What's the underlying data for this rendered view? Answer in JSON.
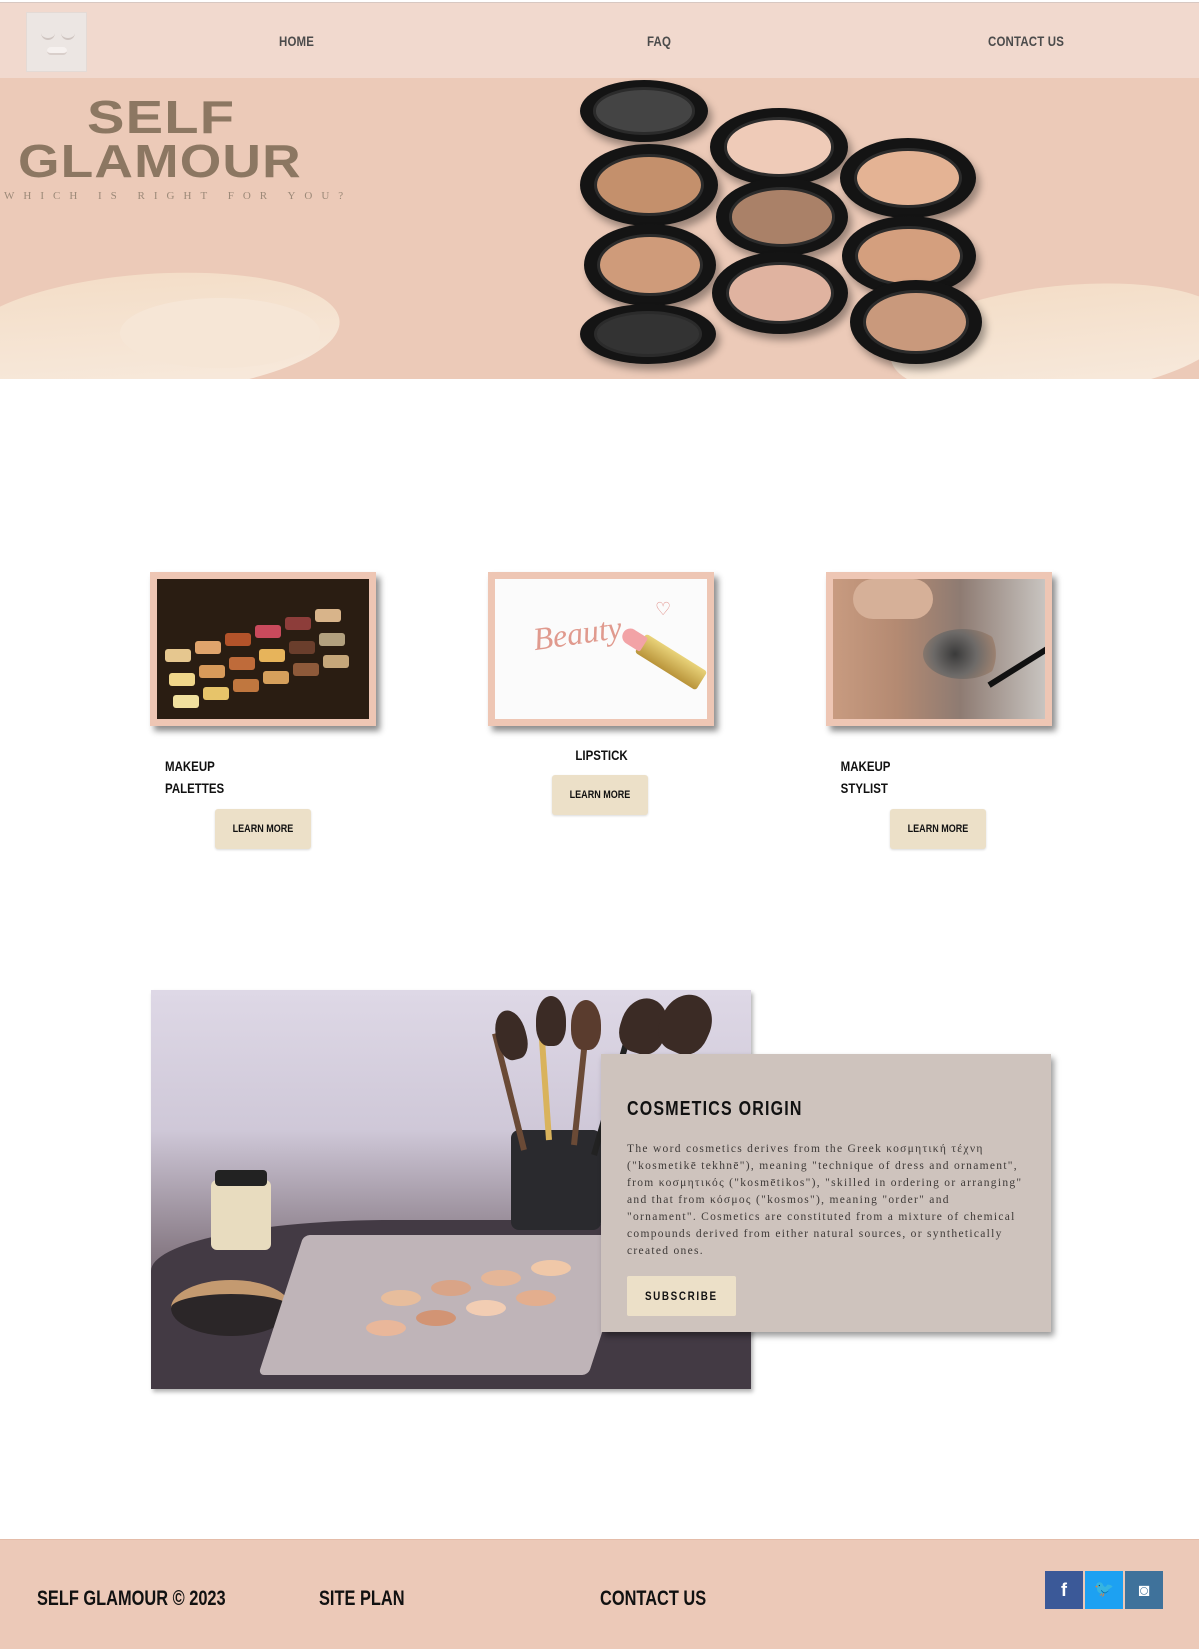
{
  "nav": {
    "logo_alt": "eyelash-logo",
    "items": [
      {
        "label": "HOME"
      },
      {
        "label": "FAQ"
      },
      {
        "label": "CONTACT US"
      }
    ]
  },
  "hero": {
    "title_line1": "SELF",
    "title_line2": "GLAMOUR",
    "tagline": "WHICH IS RIGHT FOR YOU?"
  },
  "cards": [
    {
      "label_line1": "MAKEUP",
      "label_line2": "PALETTES",
      "button": "LEARN MORE",
      "image": "eyeshadow-palette"
    },
    {
      "label_line1": "LIPSTICK",
      "label_line2": "",
      "button": "LEARN MORE",
      "image": "lipstick-beauty",
      "image_text": "Beauty"
    },
    {
      "label_line1": "MAKEUP",
      "label_line2": "STYLIST",
      "button": "LEARN MORE",
      "image": "mascara-eye"
    }
  ],
  "origin": {
    "title": "COSMETICS ORIGIN",
    "text": "The word cosmetics derives from the Greek κοσμητική τέχνη (\"kosmetikē tekhnē\"), meaning \"technique of dress and ornament\", from κοσμητικός (\"kosmētikos\"), \"skilled in ordering or arranging\" and that from κόσμος (\"kosmos\"), meaning \"order\" and \"ornament\". Cosmetics are constituted from a mixture of chemical compounds derived from either natural sources, or synthetically created ones.",
    "button": "SUBSCRIBE"
  },
  "footer": {
    "copyright": "SELF GLAMOUR © 2023",
    "site_plan": "SITE PLAN",
    "contact": "CONTACT US",
    "social": [
      {
        "icon": "facebook-icon",
        "glyph": "f",
        "color": "#3b5998"
      },
      {
        "icon": "twitter-icon",
        "glyph": "🐦",
        "color": "#1da1f2"
      },
      {
        "icon": "instagram-icon",
        "glyph": "◙",
        "color": "#3f729b"
      }
    ]
  },
  "colors": {
    "nav_bg": "#f1d9ce",
    "hero_bg": "#eccab8",
    "title_color": "#8c7762",
    "button_bg": "#ece0c8",
    "origin_box_bg": "#cec3bd",
    "footer_bg": "#ecc9b8"
  }
}
